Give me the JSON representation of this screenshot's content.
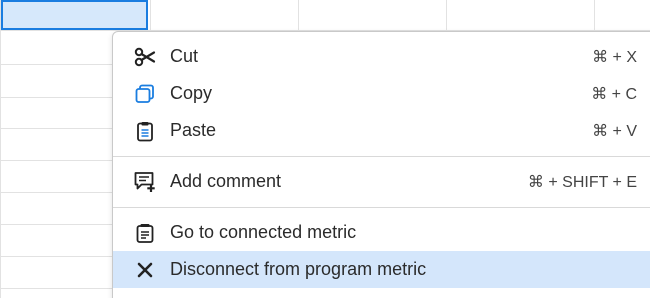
{
  "menu": {
    "items": [
      {
        "label": "Cut",
        "shortcut": "⌘ + X",
        "icon": "scissors-icon"
      },
      {
        "label": "Copy",
        "shortcut": "⌘ + C",
        "icon": "copy-icon"
      },
      {
        "label": "Paste",
        "shortcut": "⌘ + V",
        "icon": "paste-icon"
      },
      {
        "label": "Add comment",
        "shortcut": "⌘ + SHIFT + E",
        "icon": "add-comment-icon"
      },
      {
        "label": "Go to connected metric",
        "shortcut": "",
        "icon": "connected-metric-icon"
      },
      {
        "label": "Disconnect from program metric",
        "shortcut": "",
        "icon": "close-icon"
      }
    ]
  },
  "colors": {
    "selection_fill": "#d6e8fb",
    "selection_border": "#1a7de0",
    "hover_fill": "#d4e6fb",
    "copy_icon": "#1a7de0"
  }
}
